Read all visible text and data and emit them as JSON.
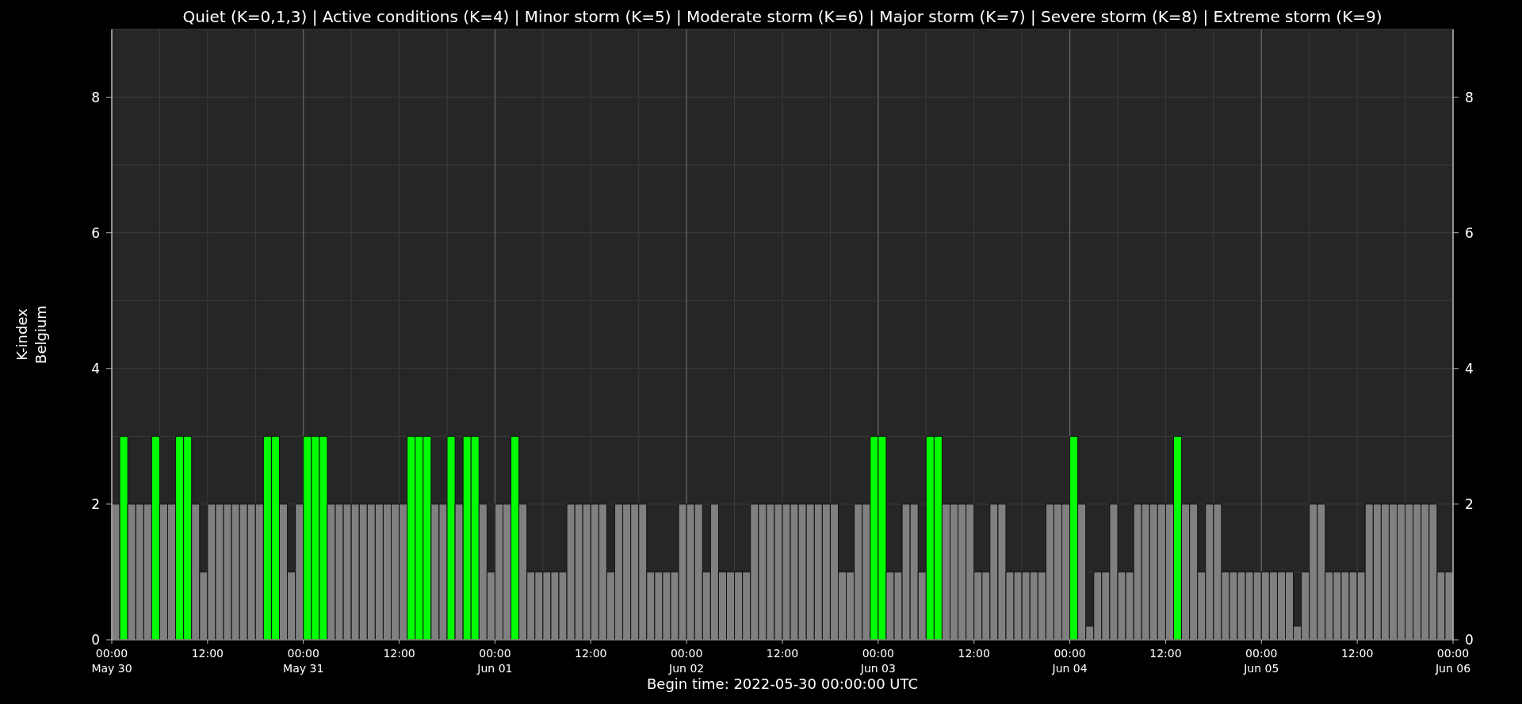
{
  "chart_data": {
    "type": "bar",
    "title": "Quiet (K=0,1,3) | Active conditions (K=4) | Minor storm (K=5) | Moderate storm (K=6) | Major storm (K=7) | Severe storm (K=8) | Extreme storm (K=9)",
    "xlabel": "Begin time: 2022-05-30 00:00:00 UTC",
    "ylabel": "K-index\nBelgium",
    "categories": [
      "00:00\nMay 30",
      null,
      null,
      null,
      null,
      null,
      null,
      null,
      null,
      null,
      null,
      null,
      "12:00",
      null,
      null,
      null,
      null,
      null,
      null,
      null,
      null,
      null,
      null,
      null,
      "00:00\nMay 31",
      null,
      null,
      null,
      null,
      null,
      null,
      null,
      null,
      null,
      null,
      null,
      "12:00",
      null,
      null,
      null,
      null,
      null,
      null,
      null,
      null,
      null,
      null,
      null,
      "00:00\nJun 01",
      null,
      null,
      null,
      null,
      null,
      null,
      null,
      null,
      null,
      null,
      null,
      "12:00",
      null,
      null,
      null,
      null,
      null,
      null,
      null,
      null,
      null,
      null,
      null,
      "00:00\nJun 02",
      null,
      null,
      null,
      null,
      null,
      null,
      null,
      null,
      null,
      null,
      null,
      "12:00",
      null,
      null,
      null,
      null,
      null,
      null,
      null,
      null,
      null,
      null,
      null,
      "00:00\nJun 03",
      null,
      null,
      null,
      null,
      null,
      null,
      null,
      null,
      null,
      null,
      null,
      "12:00",
      null,
      null,
      null,
      null,
      null,
      null,
      null,
      null,
      null,
      null,
      null,
      "00:00\nJun 04",
      null,
      null,
      null,
      null,
      null,
      null,
      null,
      null,
      null,
      null,
      null,
      "12:00",
      null,
      null,
      null,
      null,
      null,
      null,
      null,
      null,
      null,
      null,
      null,
      "00:00\nJun 05",
      null,
      null,
      null,
      null,
      null,
      null,
      null,
      null,
      null,
      null,
      null,
      "12:00",
      null,
      null,
      null,
      null,
      null,
      null,
      null,
      null,
      null,
      null,
      null
    ],
    "values": [
      2,
      3,
      2,
      2,
      2,
      3,
      2,
      2,
      3,
      3,
      2,
      1,
      2,
      2,
      2,
      2,
      2,
      2,
      2,
      3,
      3,
      2,
      1,
      2,
      3,
      3,
      3,
      2,
      2,
      2,
      2,
      2,
      2,
      2,
      2,
      2,
      2,
      3,
      3,
      3,
      2,
      2,
      3,
      2,
      3,
      3,
      2,
      1,
      2,
      2,
      3,
      2,
      1,
      1,
      1,
      1,
      1,
      2,
      2,
      2,
      2,
      2,
      1,
      2,
      2,
      2,
      2,
      1,
      1,
      1,
      1,
      2,
      2,
      2,
      1,
      2,
      1,
      1,
      1,
      1,
      2,
      2,
      2,
      2,
      2,
      2,
      2,
      2,
      2,
      2,
      2,
      1,
      1,
      2,
      2,
      3,
      3,
      1,
      1,
      2,
      2,
      1,
      3,
      3,
      2,
      2,
      2,
      2,
      1,
      1,
      2,
      2,
      1,
      1,
      1,
      1,
      1,
      2,
      2,
      2,
      3,
      2,
      0.2,
      1,
      1,
      2,
      1,
      1,
      2,
      2,
      2,
      2,
      2,
      3,
      2,
      2,
      1,
      2,
      2,
      1,
      1,
      1,
      1,
      1,
      1,
      1,
      1,
      1,
      0.2,
      1,
      2,
      2,
      1,
      1,
      1,
      1,
      1,
      2,
      2,
      2,
      2,
      2,
      2,
      2,
      2,
      2,
      1,
      1
    ],
    "ylim": [
      0,
      9
    ],
    "grid": true,
    "yticks": [
      0,
      2,
      4,
      6,
      8
    ],
    "annotations": [
      "0",
      "2",
      "4",
      "6",
      "8",
      "00:00\nJun 06"
    ]
  }
}
